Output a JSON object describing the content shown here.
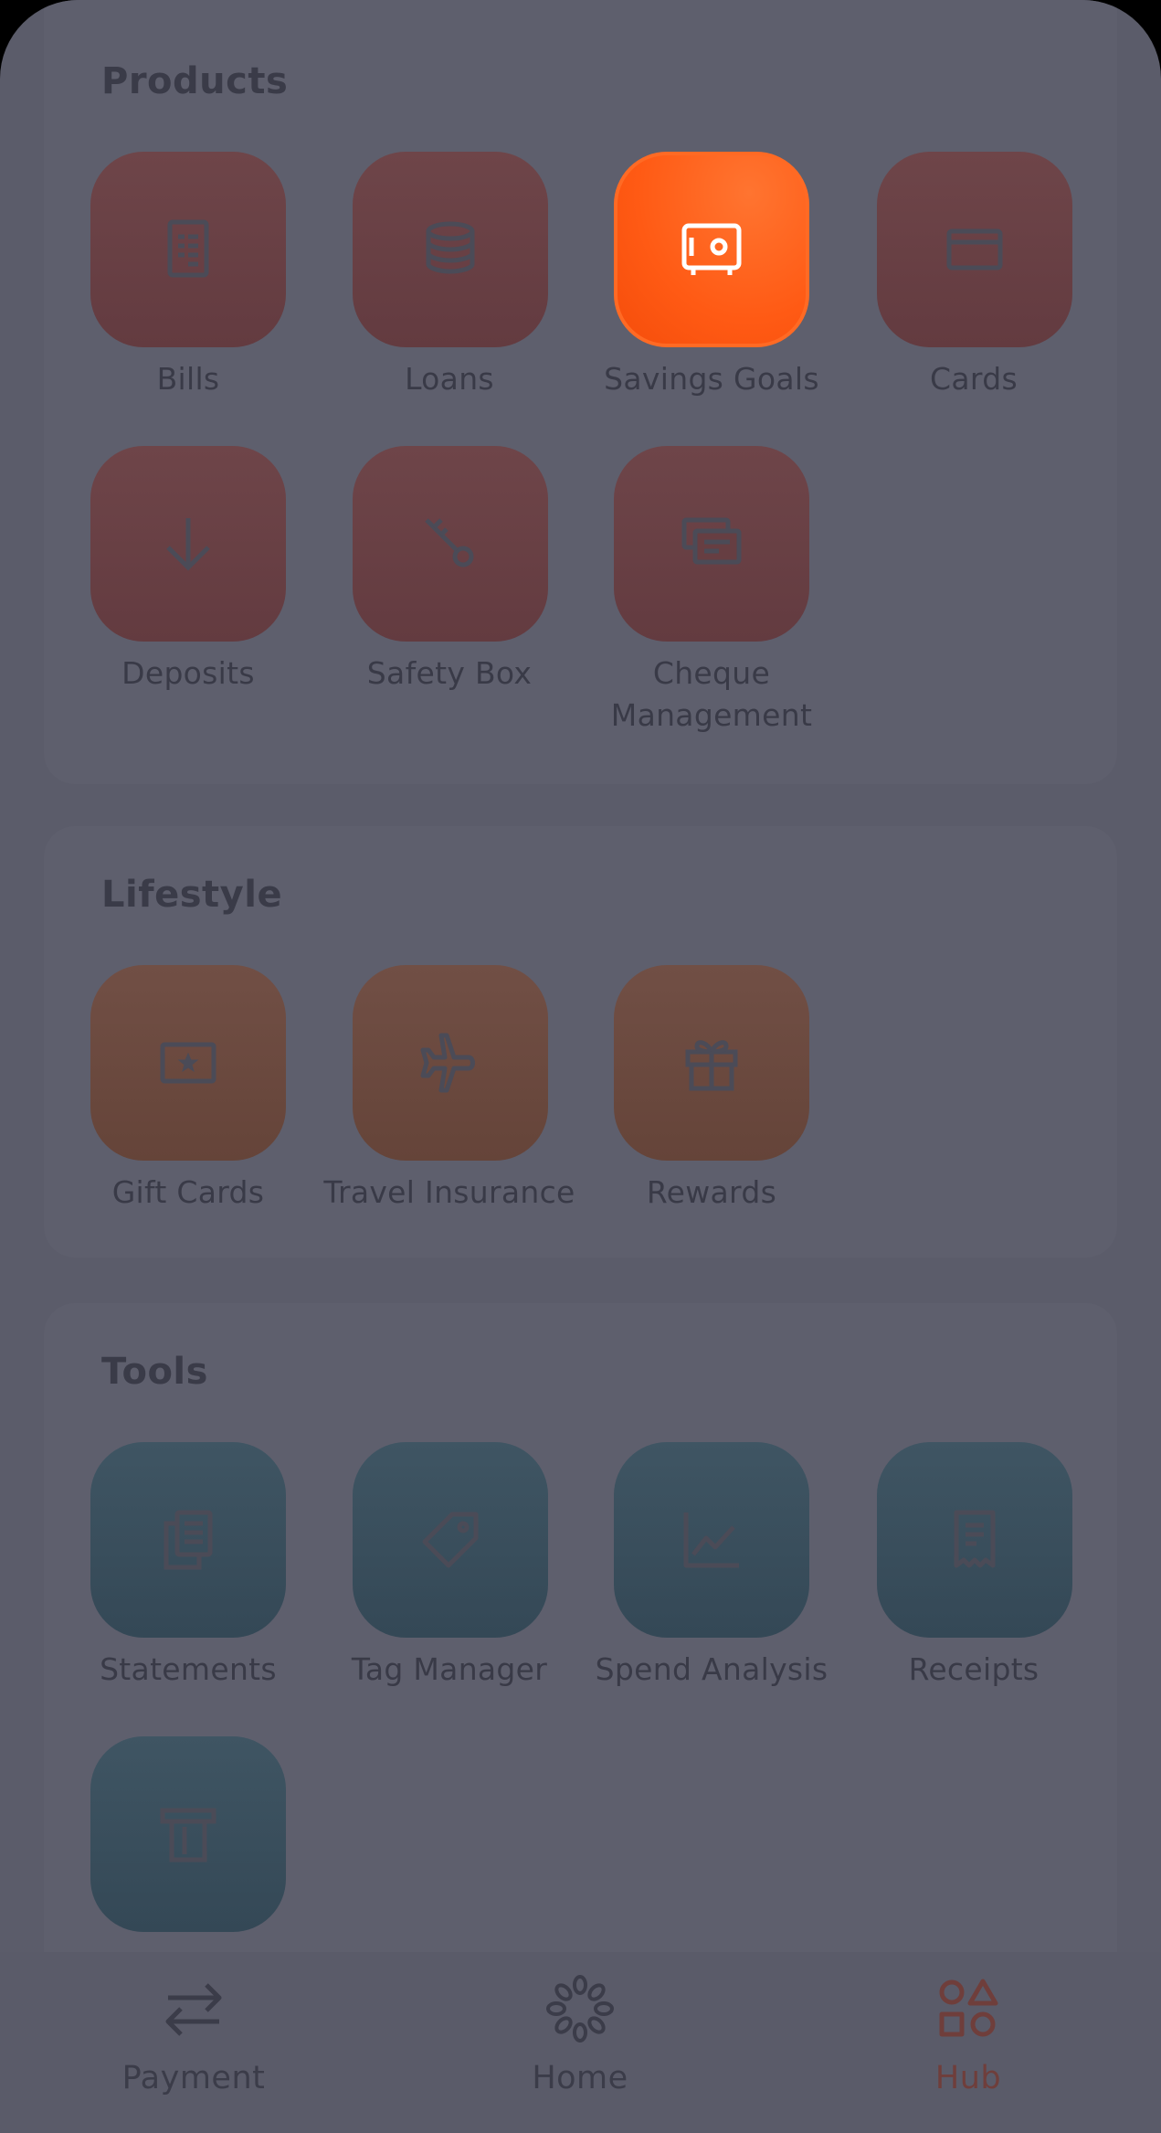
{
  "sections": {
    "products": {
      "title": "Products",
      "items": [
        {
          "label": "Bills",
          "icon": "bill-icon"
        },
        {
          "label": "Loans",
          "icon": "coins-icon"
        },
        {
          "label": "Savings Goals",
          "icon": "safe-icon",
          "selected": true
        },
        {
          "label": "Cards",
          "icon": "card-icon"
        },
        {
          "label": "Deposits",
          "icon": "arrow-down-icon"
        },
        {
          "label": "Safety Box",
          "icon": "key-icon"
        },
        {
          "label": "Cheque Management",
          "icon": "cheque-icon"
        }
      ]
    },
    "lifestyle": {
      "title": "Lifestyle",
      "items": [
        {
          "label": "Gift Cards",
          "icon": "gift-card-icon"
        },
        {
          "label": "Travel Insurance",
          "icon": "airplane-icon"
        },
        {
          "label": "Rewards",
          "icon": "gift-icon"
        }
      ]
    },
    "tools": {
      "title": "Tools",
      "items": [
        {
          "label": "Statements",
          "icon": "documents-icon"
        },
        {
          "label": "Tag Manager",
          "icon": "tag-icon"
        },
        {
          "label": "Spend Analysis",
          "icon": "line-chart-icon"
        },
        {
          "label": "Receipts",
          "icon": "receipt-icon"
        },
        {
          "label": "",
          "icon": "atm-icon"
        }
      ]
    }
  },
  "nav": {
    "payment": "Payment",
    "home": "Home",
    "hub": "Hub",
    "active": "hub"
  },
  "colors": {
    "accent": "#ff5a14",
    "active_nav": "#6f3e3b",
    "overlay": "#5b5c6a"
  }
}
